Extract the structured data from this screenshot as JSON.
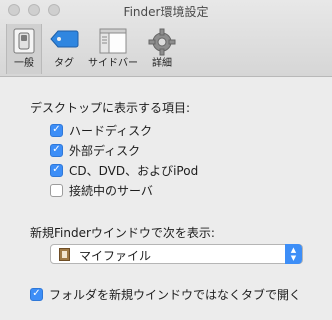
{
  "window": {
    "title": "Finder環境設定"
  },
  "toolbar": {
    "tabs": [
      {
        "label": "一般",
        "selected": true,
        "icon": "switch-icon"
      },
      {
        "label": "タグ",
        "selected": false,
        "icon": "tag-icon"
      },
      {
        "label": "サイドバー",
        "selected": false,
        "icon": "sidebar-icon"
      },
      {
        "label": "詳細",
        "selected": false,
        "icon": "gear-icon"
      }
    ]
  },
  "desktop_section": {
    "heading": "デスクトップに表示する項目:",
    "items": [
      {
        "label": "ハードディスク",
        "checked": true
      },
      {
        "label": "外部ディスク",
        "checked": true
      },
      {
        "label": "CD、DVD、およびiPod",
        "checked": true
      },
      {
        "label": "接続中のサーバ",
        "checked": false
      }
    ]
  },
  "new_window_section": {
    "heading": "新規Finderウインドウで次を表示:",
    "selected_value": "マイファイル"
  },
  "folder_tab_option": {
    "label": "フォルダを新規ウインドウではなくタブで開く",
    "checked": true
  },
  "colors": {
    "accent": "#3d8ef7",
    "window_bg": "#ececec"
  }
}
